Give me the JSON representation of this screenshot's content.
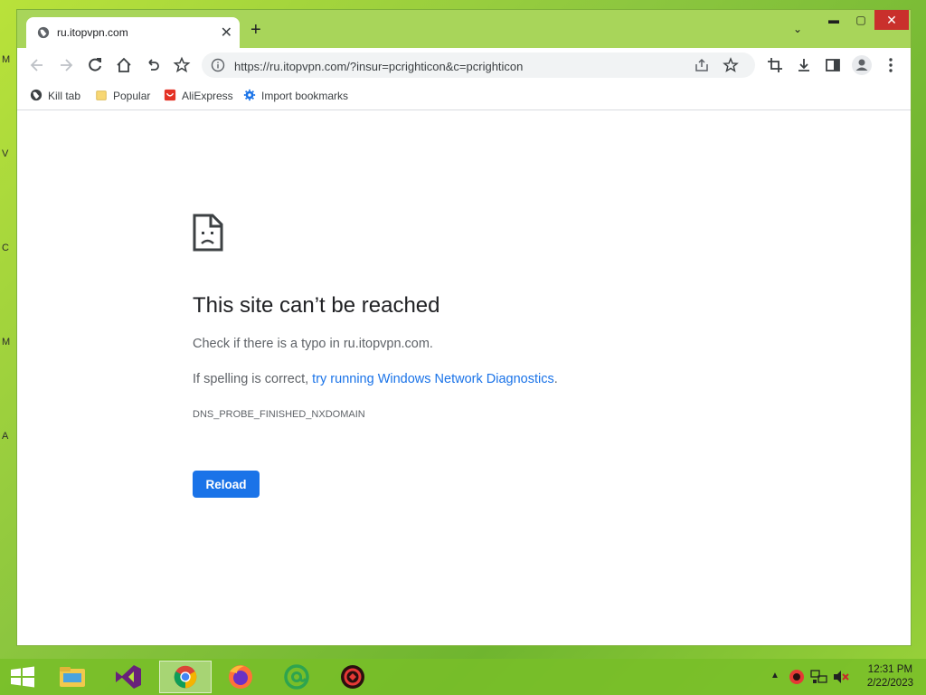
{
  "desktop": {
    "letters": [
      "M",
      "V",
      "C",
      "M",
      "A"
    ]
  },
  "browser": {
    "tab": {
      "title": "ru.itopvpn.com",
      "close": "✕"
    },
    "new_tab": "+",
    "tab_dropdown": "⌄",
    "window_controls": {
      "minimize": "▬",
      "maximize": "▢",
      "close": "✕"
    },
    "address": {
      "url": "https://ru.itopvpn.com/?insur=pcrighticon&c=pcrighticon"
    },
    "bookmarks": [
      {
        "label": "Kill tab",
        "icon": "globe-icon"
      },
      {
        "label": "Popular",
        "icon": "folder-icon"
      },
      {
        "label": "AliExpress",
        "icon": "aliexpress-icon"
      },
      {
        "label": "Import bookmarks",
        "icon": "gear-icon"
      }
    ]
  },
  "error_page": {
    "title": "This site can’t be reached",
    "line1": "Check if there is a typo in ru.itopvpn.com.",
    "line2_prefix": "If spelling is correct, ",
    "line2_link": "try running Windows Network Diagnostics",
    "line2_suffix": ".",
    "code": "DNS_PROBE_FINISHED_NXDOMAIN",
    "reload_label": "Reload"
  },
  "taskbar": {
    "apps": [
      "start-button",
      "file-explorer",
      "visual-studio",
      "chrome",
      "firefox",
      "mail-agent",
      "security-app"
    ],
    "clock": {
      "time": "12:31 PM",
      "date": "2/22/2023"
    }
  },
  "colors": {
    "accent": "#1a73e8",
    "desktop_green": "#8cc63f",
    "close_red": "#c9302c"
  }
}
